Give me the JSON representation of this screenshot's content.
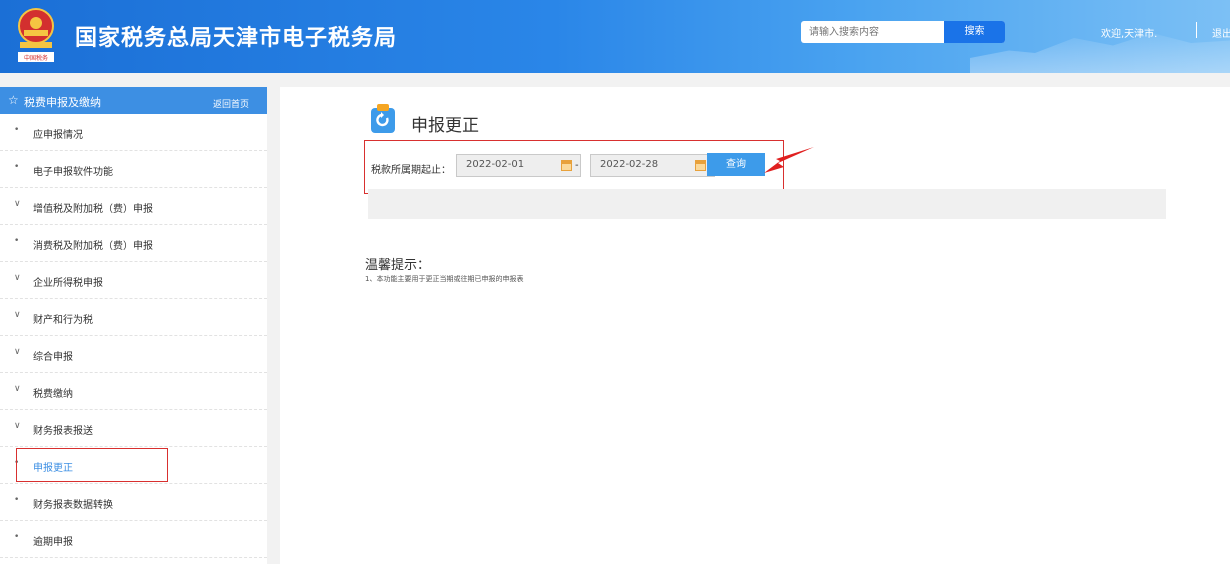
{
  "header": {
    "site_title": "国家税务总局天津市电子税务局",
    "emblem_caption": "中国税务",
    "search_placeholder": "请输入搜索内容",
    "search_button": "搜索",
    "welcome": "欢迎,天津市.",
    "logout": "退出"
  },
  "sidebar": {
    "title": "税费申报及缴纳",
    "back_home": "返回首页",
    "items": [
      {
        "marker": "•",
        "label": "应申报情况"
      },
      {
        "marker": "•",
        "label": "电子申报软件功能"
      },
      {
        "marker": "∨",
        "label": "增值税及附加税（费）申报"
      },
      {
        "marker": "•",
        "label": "消费税及附加税（费）申报"
      },
      {
        "marker": "∨",
        "label": "企业所得税申报"
      },
      {
        "marker": "∨",
        "label": "财产和行为税"
      },
      {
        "marker": "∨",
        "label": "综合申报"
      },
      {
        "marker": "∨",
        "label": "税费缴纳"
      },
      {
        "marker": "∨",
        "label": "财务报表报送"
      },
      {
        "marker": "•",
        "label": "申报更正"
      },
      {
        "marker": "•",
        "label": "财务报表数据转换"
      },
      {
        "marker": "•",
        "label": "逾期申报"
      }
    ]
  },
  "main": {
    "title": "申报更正",
    "query_label": "税款所属期起止：",
    "date_start": "2022-02-01",
    "date_separator": "-",
    "date_end": "2022-02-28",
    "query_button": "查询",
    "tips_title": "温馨提示：",
    "tips_text": "1、本功能主要用于更正当期或往期已申报的申报表"
  },
  "colors": {
    "header_blue": "#2a86e8",
    "sidebar_active": "#3d8fe3",
    "highlight_red": "#d8302f",
    "button_blue": "#3d9bea"
  }
}
